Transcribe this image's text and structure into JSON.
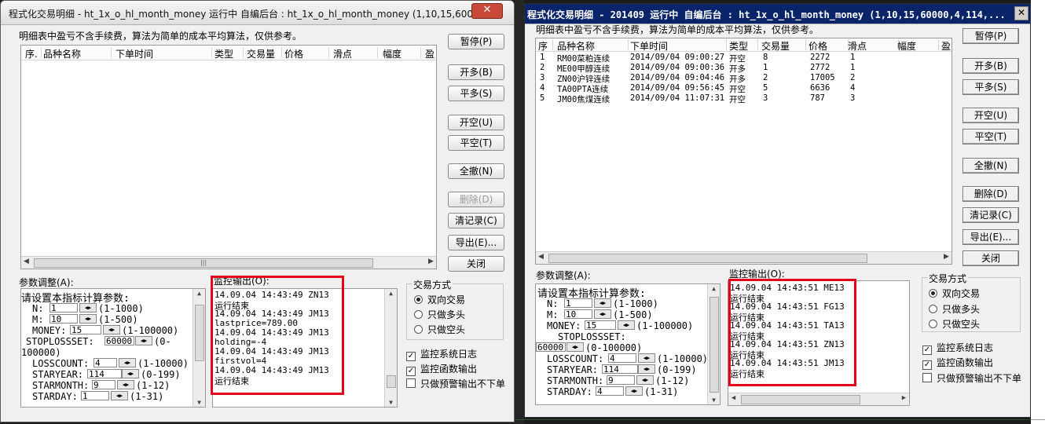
{
  "w1": {
    "title": "程式化交易明细 - ht_1x_o_hl_month_money 运行中  自编后台 : ht_1x_o_hl_month_money (1,10,15,6000...",
    "close": "✕",
    "info": "明细表中盈亏不含手续费，算法为简单的成本平均算法，仅供参考。",
    "columns": [
      "序.",
      "品种名称",
      "下单时间",
      "类型",
      "交易量",
      "价格",
      "滑点",
      "幅度",
      "盈"
    ],
    "buttons": [
      "暂停(P)",
      "开多(B)",
      "平多(S)",
      "开空(U)",
      "平空(T)",
      "全撤(N)",
      "删除(D)",
      "清记录(C)",
      "导出(E)...",
      "关闭"
    ],
    "param_label": "参数调整(A):",
    "param_header": "请设置本指标计算参数:",
    "params": [
      {
        "name": "N:",
        "value": "1",
        "range": "(1-1000)"
      },
      {
        "name": "M:",
        "value": "10",
        "range": "(1-500)"
      },
      {
        "name": "MONEY:",
        "value": "15",
        "range": "(1-100000)"
      },
      {
        "name": "STOPLOSSSET:",
        "value": "60000",
        "range": "(0-",
        "range2": "100000)"
      },
      {
        "name": "LOSSCOUNT:",
        "value": "4",
        "range": "(1-10000)"
      },
      {
        "name": "STARYEAR:",
        "value": "114",
        "range": "(0-199)"
      },
      {
        "name": "STARMONTH:",
        "value": "9",
        "range": "(1-12)"
      },
      {
        "name": "STARDAY:",
        "value": "1",
        "range": "(1-31)"
      }
    ],
    "monitor_label": "监控输出(O):",
    "monitor_lines": [
      "14.09.04 14:43:49 ZN13",
      "运行结束",
      "14.09.04 14:43:49 JM13",
      "lastprice=789.00",
      "14.09.04 14:43:49 JM13",
      "holding=-4",
      "14.09.04 14:43:49 JM13",
      "firstvol=4",
      "14.09.04 14:43:49 JM13",
      "运行结束"
    ],
    "trade_mode_label": "交易方式",
    "radios": [
      "双向交易",
      "只做多头",
      "只做空头"
    ],
    "checks": [
      "监控系统日志",
      "监控函数输出",
      "只做预警输出不下单"
    ],
    "checks_state": [
      "✓",
      "✓",
      ""
    ]
  },
  "w2": {
    "title": "程式化交易明细 - 201409 运行中  自编后台 : ht_1x_o_hl_month_money (1,10,15,60000,4,114,...",
    "close": "✕",
    "info": "明细表中盈亏不含手续费，算法为简单的成本平均算法，仅供参考。",
    "columns": [
      "序",
      "品种名称",
      "下单时间",
      "类型",
      "交易量",
      "价格",
      "滑点",
      "幅度",
      "盈"
    ],
    "rows": [
      [
        "1",
        "RM00菜粕连续",
        "2014/09/04 09:00:27",
        "开空",
        "8",
        "2272",
        "1"
      ],
      [
        "2",
        "ME00甲醇连续",
        "2014/09/04 09:00:36",
        "开多",
        "1",
        "2772",
        "1"
      ],
      [
        "3",
        "ZN00沪锌连续",
        "2014/09/04 09:04:46",
        "开多",
        "2",
        "17005",
        "2"
      ],
      [
        "4",
        "TA00PTA连续",
        "2014/09/04 09:56:45",
        "开空",
        "5",
        "6636",
        "4"
      ],
      [
        "5",
        "JM00焦煤连续",
        "2014/09/04 11:07:31",
        "开空",
        "3",
        "787",
        "3"
      ]
    ],
    "buttons": [
      "暂停(P)",
      "开多(B)",
      "平多(S)",
      "开空(U)",
      "平空(T)",
      "全撤(N)",
      "删除(D)",
      "清记录(C)",
      "导出(E)...",
      "关闭"
    ],
    "param_label": "参数调整(A):",
    "param_header": "请设置本指标计算参数:",
    "params": [
      {
        "name": "N:",
        "value": "1",
        "range": "(1-1000)"
      },
      {
        "name": "M:",
        "value": "10",
        "range": "(1-500)"
      },
      {
        "name": "MONEY:",
        "value": "15",
        "range": "(1-100000)"
      },
      {
        "name": "STOPLOSSSET:",
        "value": "60000",
        "range": "(0-100000)"
      },
      {
        "name": "LOSSCOUNT:",
        "value": "4",
        "range": "(1-10000)"
      },
      {
        "name": "STARYEAR:",
        "value": "114",
        "range": "(0-199)"
      },
      {
        "name": "STARMONTH:",
        "value": "9",
        "range": "(1-12)"
      },
      {
        "name": "STARDAY:",
        "value": "4",
        "range": "(1-31)"
      }
    ],
    "monitor_label": "监控输出(O):",
    "monitor_lines": [
      "14.09.04 14:43:51 ME13",
      "运行结束",
      "14.09.04 14:43:51 FG13",
      "运行结束",
      "14.09.04 14:43:51 TA13",
      "运行结束",
      "14.09.04 14:43:51 ZN13",
      "运行结束",
      "14.09.04 14:43:51 JM13",
      "运行结束"
    ],
    "trade_mode_label": "交易方式",
    "radios": [
      "双向交易",
      "只做多头",
      "只做空头"
    ],
    "checks": [
      "监控系统日志",
      "监控函数输出",
      "只做预警输出不下单"
    ],
    "checks_state": [
      "✓",
      "✓",
      ""
    ]
  },
  "colors": {
    "highlight_box": "#e3001b",
    "w2_titlebar": "#0a246a"
  }
}
